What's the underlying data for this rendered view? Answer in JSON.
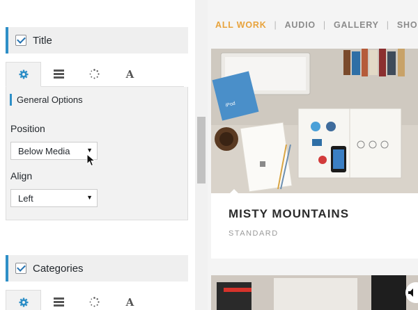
{
  "sections": [
    {
      "title": "Title",
      "checked": true,
      "tabs": [
        "gear-icon",
        "layout-icon",
        "spinner-icon",
        "typography-icon"
      ],
      "active_tab": 0,
      "panel": {
        "heading": "General Options",
        "fields": [
          {
            "label": "Position",
            "value": "Below Media"
          },
          {
            "label": "Align",
            "value": "Left"
          }
        ]
      }
    },
    {
      "title": "Categories",
      "checked": true,
      "tabs": [
        "gear-icon",
        "layout-icon",
        "spinner-icon",
        "typography-icon"
      ],
      "active_tab": 0
    }
  ],
  "preview": {
    "filters": [
      "ALL WORK",
      "AUDIO",
      "GALLERY",
      "SHOP"
    ],
    "active_filter": "ALL WORK",
    "card": {
      "title": "MISTY MOUNTAINS",
      "category": "STANDARD"
    }
  },
  "colors": {
    "accent_blue": "#2e8fc7",
    "filter_active": "#e8a33c"
  }
}
